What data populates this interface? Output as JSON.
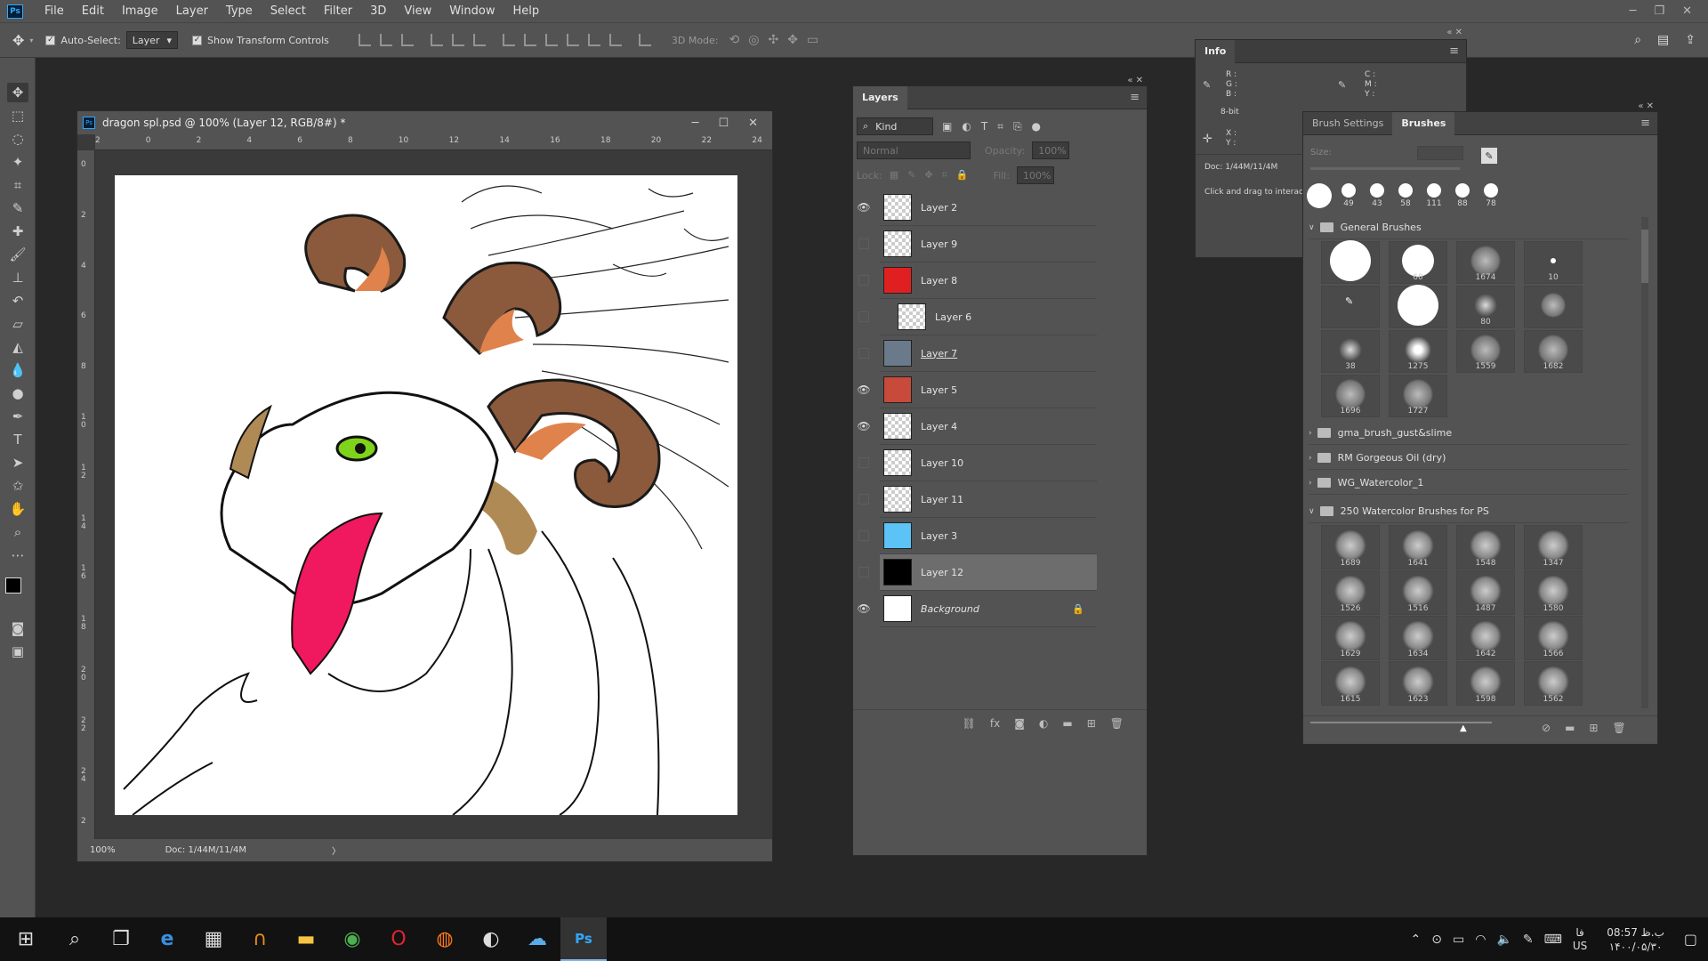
{
  "menubar": {
    "items": [
      "File",
      "Edit",
      "Image",
      "Layer",
      "Type",
      "Select",
      "Filter",
      "3D",
      "View",
      "Window",
      "Help"
    ]
  },
  "options": {
    "auto_select": "Auto-Select:",
    "auto_select_target": "Layer",
    "show_transform": "Show Transform Controls",
    "mode3d": "3D Mode:"
  },
  "document": {
    "title": "dragon spl.psd @ 100% (Layer 12, RGB/8#) *",
    "zoom": "100%",
    "doc_size": "Doc: 1/44M/11/4M",
    "ruler_h": [
      "2",
      "0",
      "2",
      "4",
      "6",
      "8",
      "10",
      "12",
      "14",
      "16",
      "18",
      "20",
      "22",
      "24"
    ],
    "ruler_v": [
      "0",
      "2",
      "4",
      "6",
      "8",
      "1 0",
      "1 2",
      "1 4",
      "1 6",
      "1 8",
      "2 0",
      "2 2",
      "2 4",
      "2"
    ]
  },
  "layers_panel": {
    "title": "Layers",
    "filter": "Kind",
    "blend": "Normal",
    "opacity_label": "Opacity:",
    "opacity": "100%",
    "lock_label": "Lock:",
    "fill_label": "Fill:",
    "fill": "100%",
    "layers": [
      {
        "name": "Layer 2",
        "visible": true
      },
      {
        "name": "Layer 9",
        "visible": false
      },
      {
        "name": "Layer 8",
        "visible": false
      },
      {
        "name": "Layer 6",
        "visible": false
      },
      {
        "name": "Layer 7",
        "visible": false
      },
      {
        "name": "Layer 5",
        "visible": true
      },
      {
        "name": "Layer 4",
        "visible": true
      },
      {
        "name": "Layer 10",
        "visible": false
      },
      {
        "name": "Layer 11",
        "visible": false
      },
      {
        "name": "Layer 3",
        "visible": false
      },
      {
        "name": "Layer 12",
        "visible": false
      },
      {
        "name": "Background",
        "visible": true
      }
    ]
  },
  "info_panel": {
    "title": "Info",
    "rgb": [
      "R :",
      "G :",
      "B :"
    ],
    "cmy": [
      "C :",
      "M :",
      "Y :"
    ],
    "bitdepth": "8-bit",
    "xy": [
      "X :",
      "Y :"
    ],
    "doc": "Doc: 1/44M/11/4M",
    "hint": "Click and drag to interact"
  },
  "brush_panel": {
    "tab_settings": "Brush Settings",
    "tab_brushes": "Brushes",
    "size_label": "Size:",
    "recent": [
      "49",
      "43",
      "58",
      "111",
      "88",
      "78"
    ],
    "general_group": "General Brushes",
    "general": [
      "",
      "60",
      "1674",
      "10",
      "",
      "",
      "80",
      "",
      "38",
      "1275",
      "1559",
      "1682",
      "1696",
      "1727"
    ],
    "groups": [
      "gma_brush_gust&slime",
      "RM Gorgeous Oil (dry)",
      "WG_Watercolor_1"
    ],
    "watercolor_group": "250 Watercolor Brushes for PS",
    "watercolor": [
      "1689",
      "1641",
      "1548",
      "1347",
      "1526",
      "1516",
      "1487",
      "1580",
      "1629",
      "1634",
      "1642",
      "1566",
      "1615",
      "1623",
      "1598",
      "1562"
    ]
  },
  "taskbar": {
    "time": "08:57 ب.ظ",
    "date": "۱۴۰۰/۰۵/۳۰",
    "lang_top": "فا",
    "lang_bottom": "US"
  }
}
